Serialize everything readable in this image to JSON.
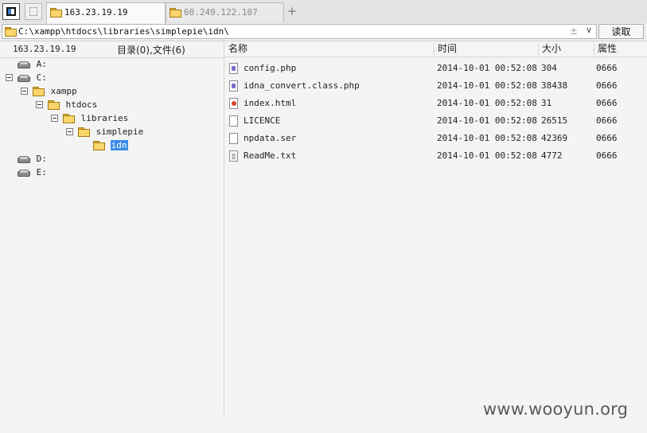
{
  "tabs": [
    {
      "label": "163.23.19.19",
      "active": true
    },
    {
      "label": "60.249.122.107",
      "active": false
    }
  ],
  "add_tab_glyph": "+",
  "path_bar": {
    "value": "C:\\xampp\\htdocs\\libraries\\simplepie\\idn\\",
    "pin_glyph": "±",
    "dropdown_glyph": "∨",
    "read_label": "读取"
  },
  "left_pane": {
    "host": "163.23.19.19",
    "counts": "目录(0),文件(6)"
  },
  "tree": [
    {
      "label": "A:",
      "kind": "drive"
    },
    {
      "label": "C:",
      "kind": "drive"
    },
    {
      "label": "xampp",
      "kind": "folder"
    },
    {
      "label": "htdocs",
      "kind": "folder"
    },
    {
      "label": "libraries",
      "kind": "folder"
    },
    {
      "label": "simplepie",
      "kind": "folder"
    },
    {
      "label": "idn",
      "kind": "folder",
      "selected": true
    },
    {
      "label": "D:",
      "kind": "drive"
    },
    {
      "label": "E:",
      "kind": "drive"
    }
  ],
  "columns": {
    "name": "名称",
    "time": "时间",
    "size": "大小",
    "attr": "属性"
  },
  "files": [
    {
      "name": "config.php",
      "time": "2014-10-01 00:52:08",
      "size": "304",
      "attr": "0666",
      "icon": "php-file-icon"
    },
    {
      "name": "idna_convert.class.php",
      "time": "2014-10-01 00:52:08",
      "size": "38438",
      "attr": "0666",
      "icon": "php-file-icon"
    },
    {
      "name": "index.html",
      "time": "2014-10-01 00:52:08",
      "size": "31",
      "attr": "0666",
      "icon": "html-file-icon"
    },
    {
      "name": "LICENCE",
      "time": "2014-10-01 00:52:08",
      "size": "26515",
      "attr": "0666",
      "icon": "blank-file-icon"
    },
    {
      "name": "npdata.ser",
      "time": "2014-10-01 00:52:08",
      "size": "42369",
      "attr": "0666",
      "icon": "blank-file-icon"
    },
    {
      "name": "ReadMe.txt",
      "time": "2014-10-01 00:52:08",
      "size": "4772",
      "attr": "0666",
      "icon": "text-file-icon"
    }
  ],
  "watermark": "www.wooyun.org",
  "colors": {
    "selection": "#3a8ee6",
    "folder": "#f9d56b"
  }
}
